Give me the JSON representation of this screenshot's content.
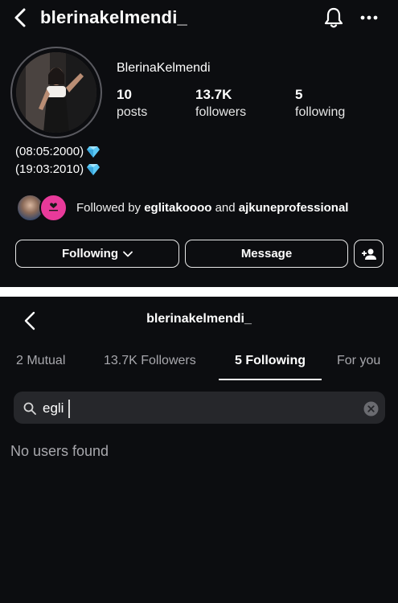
{
  "profile": {
    "username": "blerinakelmendi_",
    "display_name": "BlerinaKelmendi",
    "stats": [
      {
        "value": "10",
        "label": "posts"
      },
      {
        "value": "13.7K",
        "label": "followers"
      },
      {
        "value": "5",
        "label": "following"
      }
    ],
    "bio": [
      "(08:05:2000)",
      "(19:03:2010)"
    ],
    "followed_by": {
      "prefix": "Followed by",
      "user1": "eglitakoooo",
      "conj": "and",
      "user2": "ajkuneprofessional"
    },
    "buttons": {
      "following": "Following",
      "message": "Message"
    },
    "icons": {
      "back": "chevron-left-icon",
      "notifications": "bell-icon",
      "more": "more-horizontal-icon",
      "bio_emoji": "gem-icon",
      "add_user": "add-user-icon"
    }
  },
  "follow_list": {
    "title": "blerinakelmendi_",
    "tabs": [
      {
        "label": "2 Mutual",
        "active": false
      },
      {
        "label": "13.7K Followers",
        "active": false
      },
      {
        "label": "5 Following",
        "active": true
      },
      {
        "label": "For you",
        "active": false
      }
    ],
    "search": {
      "value": "egli"
    },
    "empty_message": "No users found"
  },
  "colors": {
    "background": "#0c0d10",
    "search_bg": "#26272b",
    "muted_text": "#a8a8ad",
    "gem": "#5bc8f5",
    "mutual_avatar_accent": "#e83a9a"
  }
}
